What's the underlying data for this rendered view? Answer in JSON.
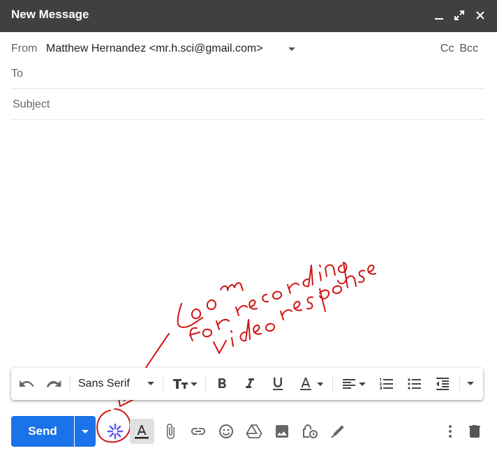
{
  "window": {
    "title": "New Message",
    "controls": [
      "minimize-icon",
      "expand-icon",
      "close-icon"
    ]
  },
  "from": {
    "label": "From",
    "value": "Matthew Hernandez <mr.h.sci@gmail.com>"
  },
  "recipients": {
    "cc": "Cc",
    "bcc": "Bcc"
  },
  "to": {
    "label": "To",
    "value": ""
  },
  "subject": {
    "placeholder": "Subject",
    "value": ""
  },
  "formatting": {
    "font": "Sans Serif",
    "icons": [
      "undo-icon",
      "redo-icon",
      "text-size-icon",
      "bold-icon",
      "italic-icon",
      "underline-icon",
      "text-color-icon",
      "align-icon",
      "numbered-list-icon",
      "bulleted-list-icon",
      "indent-less-icon",
      "more-formatting-icon"
    ]
  },
  "toolbar": {
    "send_label": "Send",
    "icons": [
      "loom-icon",
      "formatting-toggle-icon",
      "attach-icon",
      "link-icon",
      "emoji-icon",
      "drive-icon",
      "photo-icon",
      "confidential-icon",
      "signature-icon",
      "more-options-icon",
      "trash-icon"
    ]
  },
  "annotation": {
    "text": "Loom for recording video response",
    "color": "#d01414"
  },
  "colors": {
    "header_bg": "#404040",
    "send_blue": "#1a73e8",
    "loom_purple": "#625df5"
  }
}
